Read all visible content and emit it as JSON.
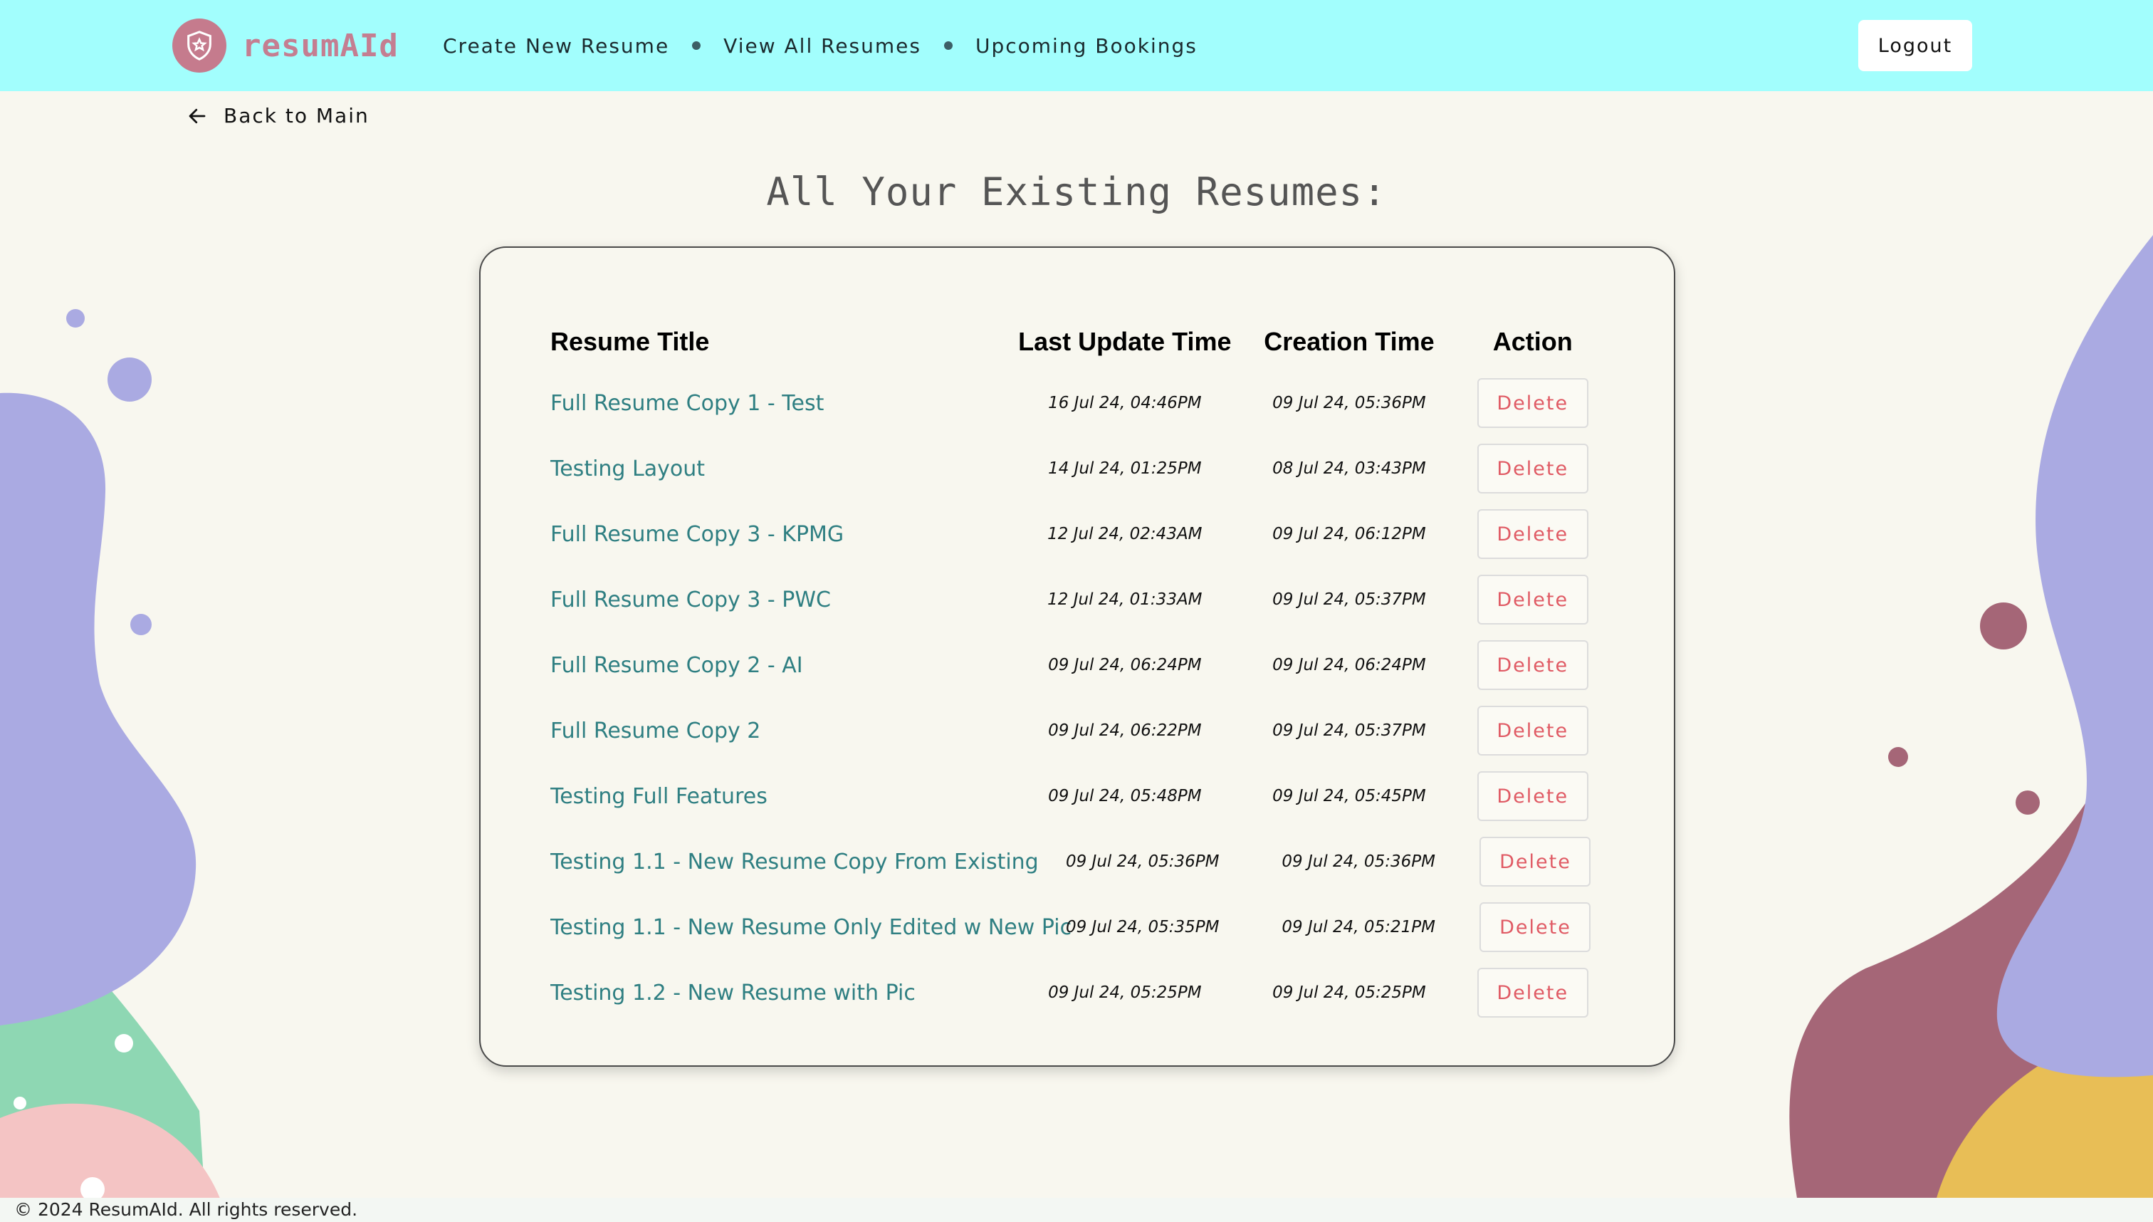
{
  "brand": {
    "name": "resumAId"
  },
  "nav": {
    "items": [
      {
        "label": "Create New Resume"
      },
      {
        "label": "View All Resumes"
      },
      {
        "label": "Upcoming Bookings"
      }
    ],
    "logout_label": "Logout"
  },
  "back": {
    "label": "Back to Main"
  },
  "page": {
    "title": "All Your Existing Resumes:"
  },
  "table": {
    "headers": {
      "title": "Resume Title",
      "updated": "Last Update Time",
      "created": "Creation Time",
      "action": "Action"
    },
    "rows": [
      {
        "title": "Full Resume Copy 1 - Test",
        "updated": "16 Jul 24, 04:46PM",
        "created": "09 Jul 24, 05:36PM",
        "action": "Delete"
      },
      {
        "title": "Testing Layout",
        "updated": "14 Jul 24, 01:25PM",
        "created": "08 Jul 24, 03:43PM",
        "action": "Delete"
      },
      {
        "title": "Full Resume Copy 3 - KPMG",
        "updated": "12 Jul 24, 02:43AM",
        "created": "09 Jul 24, 06:12PM",
        "action": "Delete"
      },
      {
        "title": "Full Resume Copy 3 - PWC",
        "updated": "12 Jul 24, 01:33AM",
        "created": "09 Jul 24, 05:37PM",
        "action": "Delete"
      },
      {
        "title": "Full Resume Copy 2 - AI",
        "updated": "09 Jul 24, 06:24PM",
        "created": "09 Jul 24, 06:24PM",
        "action": "Delete"
      },
      {
        "title": "Full Resume Copy 2",
        "updated": "09 Jul 24, 06:22PM",
        "created": "09 Jul 24, 05:37PM",
        "action": "Delete"
      },
      {
        "title": "Testing Full Features",
        "updated": "09 Jul 24, 05:48PM",
        "created": "09 Jul 24, 05:45PM",
        "action": "Delete"
      },
      {
        "title": "Testing 1.1 - New Resume Copy From Existing",
        "updated": "09 Jul 24, 05:36PM",
        "created": "09 Jul 24, 05:36PM",
        "action": "Delete"
      },
      {
        "title": "Testing 1.1 - New Resume Only Edited w New Pic",
        "updated": "09 Jul 24, 05:35PM",
        "created": "09 Jul 24, 05:21PM",
        "action": "Delete"
      },
      {
        "title": "Testing 1.2 - New Resume with Pic",
        "updated": "09 Jul 24, 05:25PM",
        "created": "09 Jul 24, 05:25PM",
        "action": "Delete"
      }
    ]
  },
  "footer": {
    "text": "© 2024 ResumAId. All rights reserved."
  },
  "icons": {
    "brand": "shield-star-icon",
    "back": "arrow-left-icon"
  },
  "colors": {
    "header_bg": "#a2fefd",
    "page_bg": "#f8f7ef",
    "brand": "#c47e91",
    "link": "#2f7f82",
    "delete": "#e05a64",
    "blob_lavender": "#aaaae2",
    "blob_mauve": "#a56677",
    "blob_mint": "#8ed7b3",
    "blob_pink": "#f4c4c4",
    "blob_gold": "#e8be56"
  }
}
